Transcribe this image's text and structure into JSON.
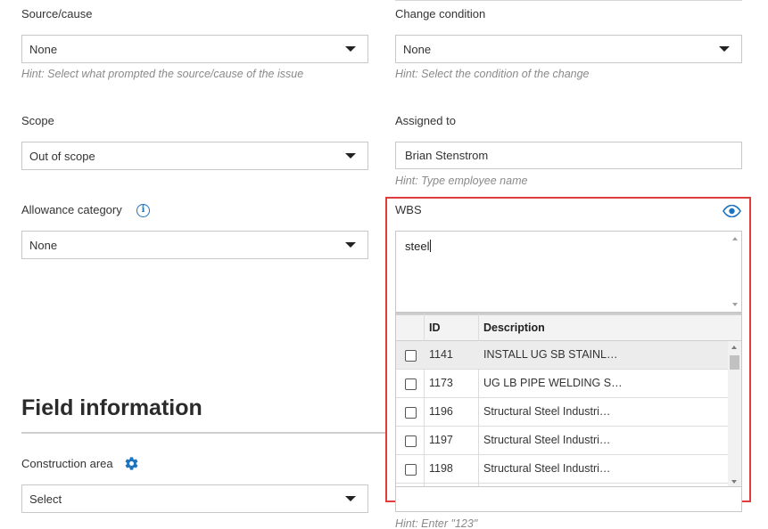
{
  "source_cause": {
    "label": "Source/cause",
    "value": "None",
    "hint": "Hint: Select what prompted the source/cause of the issue"
  },
  "change_condition": {
    "label": "Change condition",
    "value": "None",
    "hint": "Hint: Select the condition of the change"
  },
  "scope": {
    "label": "Scope",
    "value": "Out of scope"
  },
  "assigned_to": {
    "label": "Assigned to",
    "value": "Brian Stenstrom",
    "hint": "Hint: Type employee name"
  },
  "allowance_category": {
    "label": "Allowance category",
    "value": "None",
    "info_icon": "info-icon"
  },
  "wbs": {
    "label": "WBS",
    "search_value": "steel",
    "eye_icon": "eye-icon",
    "columns": {
      "id": "ID",
      "description": "Description"
    },
    "rows": [
      {
        "id": "1141",
        "description": "INSTALL UG SB STAINL…"
      },
      {
        "id": "1173",
        "description": "UG LB PIPE WELDING S…"
      },
      {
        "id": "1196",
        "description": "Structural Steel Industri…"
      },
      {
        "id": "1197",
        "description": "Structural Steel Industri…"
      },
      {
        "id": "1198",
        "description": "Structural Steel Industri…"
      }
    ]
  },
  "field_information": {
    "title": "Field information"
  },
  "construction_area": {
    "label": "Construction area",
    "value": "Select",
    "icon": "gear-icon"
  },
  "bottom_field": {
    "hint": "Hint: Enter \"123\""
  },
  "colors": {
    "accent": "#1e73be",
    "highlight": "#e03c3c"
  }
}
